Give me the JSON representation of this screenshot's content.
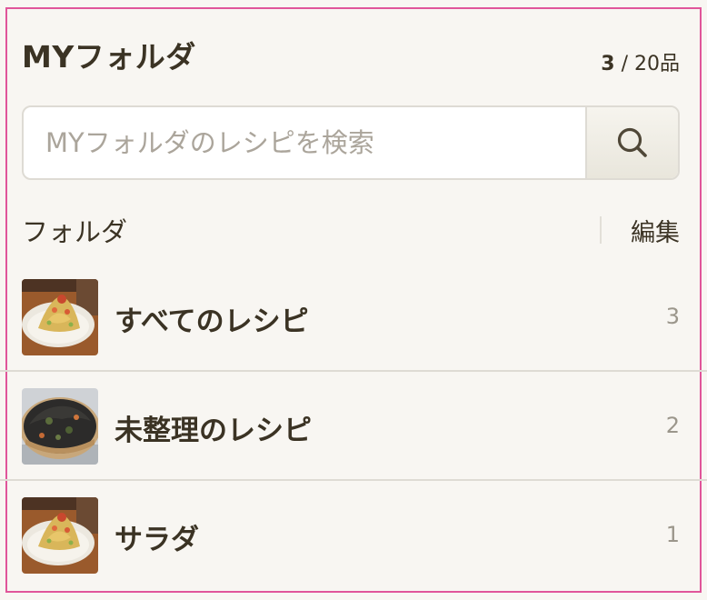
{
  "header": {
    "title": "MYフォルダ",
    "count_current": "3",
    "count_suffix": " / 20品"
  },
  "search": {
    "placeholder": "MYフォルダのレシピを検索",
    "value": "",
    "button_icon": "search-icon"
  },
  "folders": {
    "label": "フォルダ",
    "edit_label": "編集",
    "items": [
      {
        "name": "すべてのレシピ",
        "count": "3",
        "thumbnail": "food-photo-salad"
      },
      {
        "name": "未整理のレシピ",
        "count": "2",
        "thumbnail": "food-photo-okonomiyaki"
      },
      {
        "name": "サラダ",
        "count": "1",
        "thumbnail": "food-photo-salad"
      }
    ]
  },
  "colors": {
    "accent_border": "#e0559a",
    "text_main": "#3b3324",
    "text_muted": "#9b968b",
    "background": "#f8f6f2"
  }
}
